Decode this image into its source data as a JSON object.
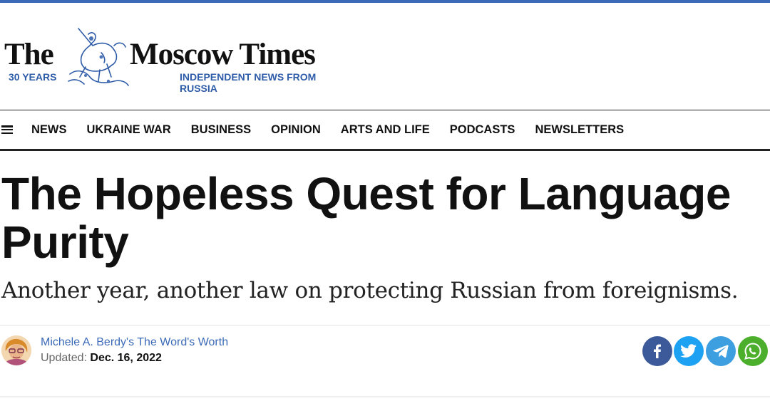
{
  "brand": {
    "word_the": "The",
    "word_rest": "Moscow Times",
    "years": "30 YEARS",
    "tagline": "INDEPENDENT NEWS FROM RUSSIA",
    "accent_color": "#2f5ca8"
  },
  "nav": {
    "menu_icon": "hamburger-menu-icon",
    "items": [
      {
        "label": "NEWS"
      },
      {
        "label": "UKRAINE WAR"
      },
      {
        "label": "BUSINESS"
      },
      {
        "label": "OPINION"
      },
      {
        "label": "ARTS AND LIFE"
      },
      {
        "label": "PODCASTS"
      },
      {
        "label": "NEWSLETTERS"
      }
    ]
  },
  "article": {
    "title": "The Hopeless Quest for Language Purity",
    "subtitle": "Another year, another law on protecting Russian from foreignisms.",
    "author": "Michele A. Berdy's The Word's Worth",
    "updated_label": "Updated:",
    "updated_date": "Dec. 16, 2022"
  },
  "share": [
    {
      "icon": "facebook-icon",
      "color": "#3c5a99"
    },
    {
      "icon": "twitter-icon",
      "color": "#1da1f2"
    },
    {
      "icon": "telegram-icon",
      "color": "#3d9ee0"
    },
    {
      "icon": "whatsapp-icon",
      "color": "#4caf2c"
    }
  ]
}
